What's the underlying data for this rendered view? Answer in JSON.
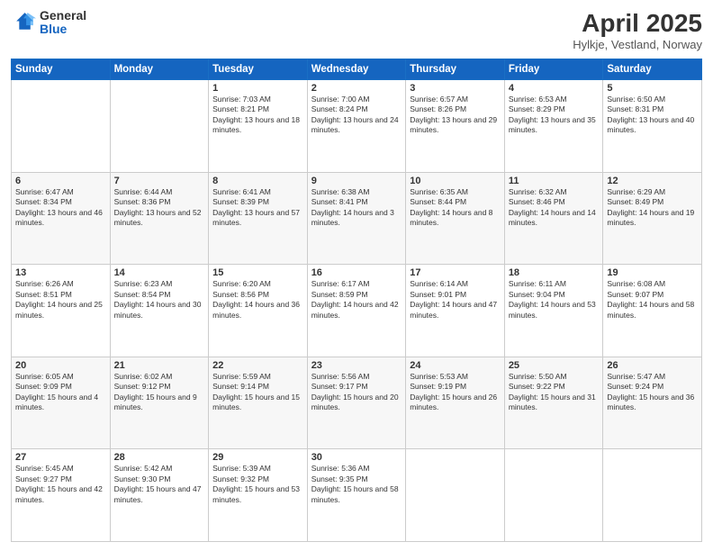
{
  "logo": {
    "general": "General",
    "blue": "Blue"
  },
  "title": {
    "month": "April 2025",
    "location": "Hylkje, Vestland, Norway"
  },
  "header_days": [
    "Sunday",
    "Monday",
    "Tuesday",
    "Wednesday",
    "Thursday",
    "Friday",
    "Saturday"
  ],
  "weeks": [
    [
      {
        "day": "",
        "info": ""
      },
      {
        "day": "",
        "info": ""
      },
      {
        "day": "1",
        "info": "Sunrise: 7:03 AM\nSunset: 8:21 PM\nDaylight: 13 hours and 18 minutes."
      },
      {
        "day": "2",
        "info": "Sunrise: 7:00 AM\nSunset: 8:24 PM\nDaylight: 13 hours and 24 minutes."
      },
      {
        "day": "3",
        "info": "Sunrise: 6:57 AM\nSunset: 8:26 PM\nDaylight: 13 hours and 29 minutes."
      },
      {
        "day": "4",
        "info": "Sunrise: 6:53 AM\nSunset: 8:29 PM\nDaylight: 13 hours and 35 minutes."
      },
      {
        "day": "5",
        "info": "Sunrise: 6:50 AM\nSunset: 8:31 PM\nDaylight: 13 hours and 40 minutes."
      }
    ],
    [
      {
        "day": "6",
        "info": "Sunrise: 6:47 AM\nSunset: 8:34 PM\nDaylight: 13 hours and 46 minutes."
      },
      {
        "day": "7",
        "info": "Sunrise: 6:44 AM\nSunset: 8:36 PM\nDaylight: 13 hours and 52 minutes."
      },
      {
        "day": "8",
        "info": "Sunrise: 6:41 AM\nSunset: 8:39 PM\nDaylight: 13 hours and 57 minutes."
      },
      {
        "day": "9",
        "info": "Sunrise: 6:38 AM\nSunset: 8:41 PM\nDaylight: 14 hours and 3 minutes."
      },
      {
        "day": "10",
        "info": "Sunrise: 6:35 AM\nSunset: 8:44 PM\nDaylight: 14 hours and 8 minutes."
      },
      {
        "day": "11",
        "info": "Sunrise: 6:32 AM\nSunset: 8:46 PM\nDaylight: 14 hours and 14 minutes."
      },
      {
        "day": "12",
        "info": "Sunrise: 6:29 AM\nSunset: 8:49 PM\nDaylight: 14 hours and 19 minutes."
      }
    ],
    [
      {
        "day": "13",
        "info": "Sunrise: 6:26 AM\nSunset: 8:51 PM\nDaylight: 14 hours and 25 minutes."
      },
      {
        "day": "14",
        "info": "Sunrise: 6:23 AM\nSunset: 8:54 PM\nDaylight: 14 hours and 30 minutes."
      },
      {
        "day": "15",
        "info": "Sunrise: 6:20 AM\nSunset: 8:56 PM\nDaylight: 14 hours and 36 minutes."
      },
      {
        "day": "16",
        "info": "Sunrise: 6:17 AM\nSunset: 8:59 PM\nDaylight: 14 hours and 42 minutes."
      },
      {
        "day": "17",
        "info": "Sunrise: 6:14 AM\nSunset: 9:01 PM\nDaylight: 14 hours and 47 minutes."
      },
      {
        "day": "18",
        "info": "Sunrise: 6:11 AM\nSunset: 9:04 PM\nDaylight: 14 hours and 53 minutes."
      },
      {
        "day": "19",
        "info": "Sunrise: 6:08 AM\nSunset: 9:07 PM\nDaylight: 14 hours and 58 minutes."
      }
    ],
    [
      {
        "day": "20",
        "info": "Sunrise: 6:05 AM\nSunset: 9:09 PM\nDaylight: 15 hours and 4 minutes."
      },
      {
        "day": "21",
        "info": "Sunrise: 6:02 AM\nSunset: 9:12 PM\nDaylight: 15 hours and 9 minutes."
      },
      {
        "day": "22",
        "info": "Sunrise: 5:59 AM\nSunset: 9:14 PM\nDaylight: 15 hours and 15 minutes."
      },
      {
        "day": "23",
        "info": "Sunrise: 5:56 AM\nSunset: 9:17 PM\nDaylight: 15 hours and 20 minutes."
      },
      {
        "day": "24",
        "info": "Sunrise: 5:53 AM\nSunset: 9:19 PM\nDaylight: 15 hours and 26 minutes."
      },
      {
        "day": "25",
        "info": "Sunrise: 5:50 AM\nSunset: 9:22 PM\nDaylight: 15 hours and 31 minutes."
      },
      {
        "day": "26",
        "info": "Sunrise: 5:47 AM\nSunset: 9:24 PM\nDaylight: 15 hours and 36 minutes."
      }
    ],
    [
      {
        "day": "27",
        "info": "Sunrise: 5:45 AM\nSunset: 9:27 PM\nDaylight: 15 hours and 42 minutes."
      },
      {
        "day": "28",
        "info": "Sunrise: 5:42 AM\nSunset: 9:30 PM\nDaylight: 15 hours and 47 minutes."
      },
      {
        "day": "29",
        "info": "Sunrise: 5:39 AM\nSunset: 9:32 PM\nDaylight: 15 hours and 53 minutes."
      },
      {
        "day": "30",
        "info": "Sunrise: 5:36 AM\nSunset: 9:35 PM\nDaylight: 15 hours and 58 minutes."
      },
      {
        "day": "",
        "info": ""
      },
      {
        "day": "",
        "info": ""
      },
      {
        "day": "",
        "info": ""
      }
    ]
  ]
}
